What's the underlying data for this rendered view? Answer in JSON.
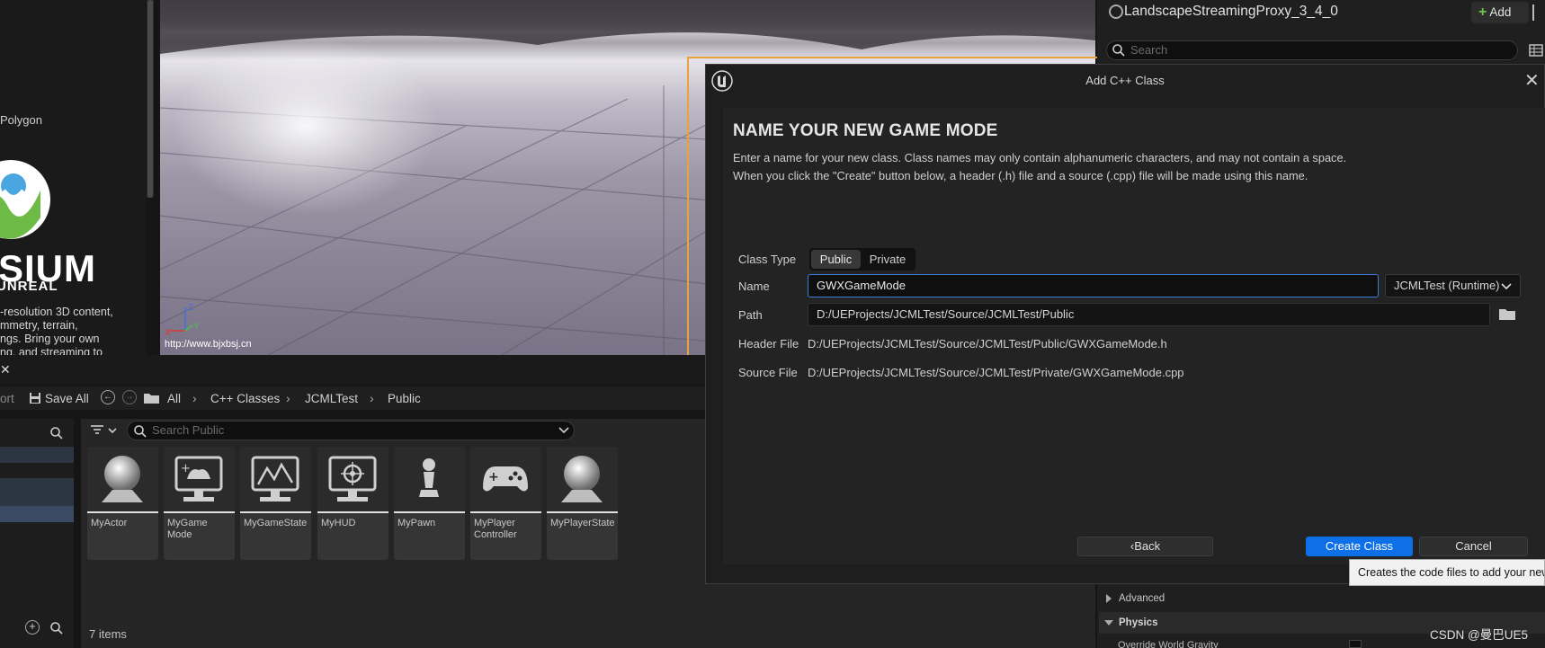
{
  "left_panel": {
    "polygon_label": "Polygon",
    "logo_main": "SIUM",
    "logo_sub": "UNREAL",
    "description_lines": [
      "-resolution 3D content,",
      "mmetry, terrain,",
      "ngs. Bring your own",
      "ng, and streaming to"
    ]
  },
  "viewport": {
    "url_text": "http://www.bjxbsj.cn",
    "axis_labels": {
      "x": "X",
      "y": "Y",
      "z": "Z"
    }
  },
  "details": {
    "actor_name": "LandscapeStreamingProxy_3_4_0",
    "add_label": "Add",
    "search_placeholder": "Search",
    "sections": [
      {
        "label": "Advanced"
      },
      {
        "label": "Physics"
      }
    ],
    "override_label": "Override World Gravity"
  },
  "content_browser": {
    "toolbar": {
      "import_partial": "ort",
      "save_all": "Save All"
    },
    "breadcrumb": [
      "All",
      "C++ Classes",
      "JCMLTest",
      "Public"
    ],
    "search_placeholder": "Search Public",
    "assets": [
      {
        "name": "MyActor",
        "icon": "sphere-icon"
      },
      {
        "name": "MyGame Mode",
        "icon": "gamemode-icon"
      },
      {
        "name": "MyGameState",
        "icon": "gamestate-icon"
      },
      {
        "name": "MyHUD",
        "icon": "hud-icon"
      },
      {
        "name": "MyPawn",
        "icon": "pawn-icon"
      },
      {
        "name": "MyPlayer Controller",
        "icon": "controller-icon"
      },
      {
        "name": "MyPlayerState",
        "icon": "sphere-icon"
      }
    ],
    "items_count": "7 items"
  },
  "dialog": {
    "title": "Add C++ Class",
    "heading": "NAME YOUR NEW GAME MODE",
    "desc_line1": "Enter a name for your new class. Class names may only contain alphanumeric characters, and may not contain a space.",
    "desc_line2": "When you click the \"Create\" button below, a header (.h) file and a source (.cpp) file will be made using this name.",
    "class_type_label": "Class Type",
    "class_type_options": {
      "public": "Public",
      "private": "Private",
      "selected": "Public"
    },
    "name_label": "Name",
    "name_value": "GWXGameMode",
    "module_value": "JCMLTest (Runtime)",
    "path_label": "Path",
    "path_value": "D:/UEProjects/JCMLTest/Source/JCMLTest/Public",
    "header_label": "Header File",
    "header_value": "D:/UEProjects/JCMLTest/Source/JCMLTest/Public/GWXGameMode.h",
    "source_label": "Source File",
    "source_value": "D:/UEProjects/JCMLTest/Source/JCMLTest/Private/GWXGameMode.cpp",
    "back_label": "Back",
    "create_label": "Create Class",
    "cancel_label": "Cancel",
    "tooltip": "Creates the code files to add your new"
  },
  "watermark": "CSDN @曼巴UE5",
  "colors": {
    "accent_blue": "#0e70e8",
    "selection_orange": "#e8a33d",
    "add_green": "#6ec34b"
  }
}
